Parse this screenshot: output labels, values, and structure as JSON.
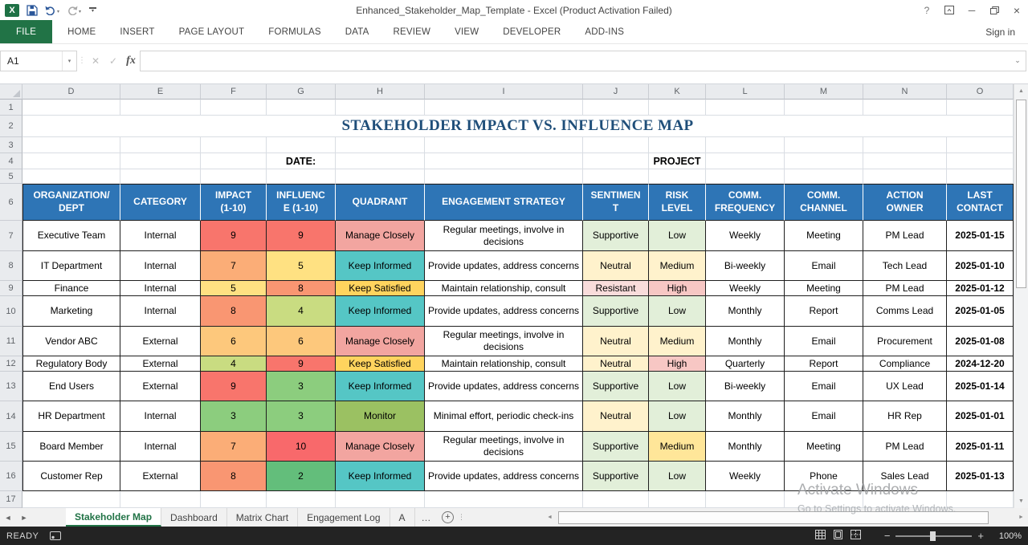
{
  "titlebar": {
    "title": "Enhanced_Stakeholder_Map_Template - Excel (Product Activation Failed)",
    "help_glyph": "?"
  },
  "ribbon": {
    "tabs": [
      "FILE",
      "HOME",
      "INSERT",
      "PAGE LAYOUT",
      "FORMULAS",
      "DATA",
      "REVIEW",
      "VIEW",
      "DEVELOPER",
      "ADD-INS"
    ],
    "sign_in": "Sign in"
  },
  "formula_bar": {
    "name_box": "A1",
    "cancel_glyph": "✕",
    "enter_glyph": "✓",
    "fx_label": "fx",
    "formula_value": ""
  },
  "grid": {
    "column_letters": [
      "D",
      "E",
      "F",
      "G",
      "H",
      "I",
      "J",
      "K",
      "L",
      "M",
      "N",
      "O"
    ],
    "row_count": 17,
    "title": "STAKEHOLDER IMPACT VS. INFLUENCE MAP",
    "date_label": "DATE:",
    "project_label": "PROJECT"
  },
  "table": {
    "headers": [
      "ORGANIZATION/\nDEPT",
      "CATEGORY",
      "IMPACT\n(1-10)",
      "INFLUENC\nE (1-10)",
      "QUADRANT",
      "ENGAGEMENT STRATEGY",
      "SENTIMEN\nT",
      "RISK\nLEVEL",
      "COMM.\nFREQUENCY",
      "COMM.\nCHANNEL",
      "ACTION\nOWNER",
      "LAST\nCONTACT"
    ],
    "rows": [
      {
        "org": "Executive Team",
        "category": "Internal",
        "impact": "9",
        "impact_color": "#F8756C",
        "influence": "9",
        "influence_color": "#F8756C",
        "quadrant": "Manage Closely",
        "quadrant_color": "#F2A5A0",
        "strategy": "Regular meetings, involve in decisions",
        "sentiment": "Supportive",
        "sentiment_color": "#E2EFD9",
        "risk": "Low",
        "risk_color": "#E2EFD9",
        "frequency": "Weekly",
        "channel": "Meeting",
        "owner": "PM Lead",
        "last_contact": "2025-01-15"
      },
      {
        "org": "IT Department",
        "category": "Internal",
        "impact": "7",
        "impact_color": "#FBAD77",
        "influence": "5",
        "influence_color": "#FFE182",
        "quadrant": "Keep Informed",
        "quadrant_color": "#55C6C5",
        "strategy": "Provide updates, address concerns",
        "sentiment": "Neutral",
        "sentiment_color": "#FFF2CC",
        "risk": "Medium",
        "risk_color": "#FFF2CC",
        "frequency": "Bi-weekly",
        "channel": "Email",
        "owner": "Tech Lead",
        "last_contact": "2025-01-10"
      },
      {
        "org": "Finance",
        "category": "Internal",
        "impact": "5",
        "impact_color": "#FFE182",
        "influence": "8",
        "influence_color": "#F99672",
        "quadrant": "Keep Satisfied",
        "quadrant_color": "#FFD45E",
        "strategy": "Maintain relationship, consult",
        "sentiment": "Resistant",
        "sentiment_color": "#F9DCDB",
        "risk": "High",
        "risk_color": "#F7C7C4",
        "frequency": "Weekly",
        "channel": "Meeting",
        "owner": "PM Lead",
        "last_contact": "2025-01-12"
      },
      {
        "org": "Marketing",
        "category": "Internal",
        "impact": "8",
        "impact_color": "#F99672",
        "influence": "4",
        "influence_color": "#C9DC81",
        "quadrant": "Keep Informed",
        "quadrant_color": "#55C6C5",
        "strategy": "Provide updates, address concerns",
        "sentiment": "Supportive",
        "sentiment_color": "#E2EFD9",
        "risk": "Low",
        "risk_color": "#E2EFD9",
        "frequency": "Monthly",
        "channel": "Report",
        "owner": "Comms Lead",
        "last_contact": "2025-01-05"
      },
      {
        "org": "Vendor ABC",
        "category": "External",
        "impact": "6",
        "impact_color": "#FDC87C",
        "influence": "6",
        "influence_color": "#FDC87C",
        "quadrant": "Manage Closely",
        "quadrant_color": "#F2A5A0",
        "strategy": "Regular meetings, involve in decisions",
        "sentiment": "Neutral",
        "sentiment_color": "#FFF2CC",
        "risk": "Medium",
        "risk_color": "#FFF2CC",
        "frequency": "Monthly",
        "channel": "Email",
        "owner": "Procurement",
        "last_contact": "2025-01-08"
      },
      {
        "org": "Regulatory Body",
        "category": "External",
        "impact": "4",
        "impact_color": "#C9DC81",
        "influence": "9",
        "influence_color": "#F8756C",
        "quadrant": "Keep Satisfied",
        "quadrant_color": "#FFD45E",
        "strategy": "Maintain relationship, consult",
        "sentiment": "Neutral",
        "sentiment_color": "#FFF2CC",
        "risk": "High",
        "risk_color": "#F7C7C4",
        "frequency": "Quarterly",
        "channel": "Report",
        "owner": "Compliance",
        "last_contact": "2024-12-20"
      },
      {
        "org": "End Users",
        "category": "External",
        "impact": "9",
        "impact_color": "#F8756C",
        "influence": "3",
        "influence_color": "#8CCD7E",
        "quadrant": "Keep Informed",
        "quadrant_color": "#55C6C5",
        "strategy": "Provide updates, address concerns",
        "sentiment": "Supportive",
        "sentiment_color": "#E2EFD9",
        "risk": "Low",
        "risk_color": "#E2EFD9",
        "frequency": "Bi-weekly",
        "channel": "Email",
        "owner": "UX Lead",
        "last_contact": "2025-01-14"
      },
      {
        "org": "HR Department",
        "category": "Internal",
        "impact": "3",
        "impact_color": "#8CCD7E",
        "influence": "3",
        "influence_color": "#8CCD7E",
        "quadrant": "Monitor",
        "quadrant_color": "#9BC162",
        "strategy": "Minimal effort, periodic check-ins",
        "sentiment": "Neutral",
        "sentiment_color": "#FFF2CC",
        "risk": "Low",
        "risk_color": "#E2EFD9",
        "frequency": "Monthly",
        "channel": "Email",
        "owner": "HR Rep",
        "last_contact": "2025-01-01"
      },
      {
        "org": "Board Member",
        "category": "Internal",
        "impact": "7",
        "impact_color": "#FBAD77",
        "influence": "10",
        "influence_color": "#F8696B",
        "quadrant": "Manage Closely",
        "quadrant_color": "#F2A5A0",
        "strategy": "Regular meetings, involve in decisions",
        "sentiment": "Supportive",
        "sentiment_color": "#E2EFD9",
        "risk": "Medium",
        "risk_color": "#FFE699",
        "frequency": "Monthly",
        "channel": "Meeting",
        "owner": "PM Lead",
        "last_contact": "2025-01-11"
      },
      {
        "org": "Customer Rep",
        "category": "External",
        "impact": "8",
        "impact_color": "#F99672",
        "influence": "2",
        "influence_color": "#63BE7B",
        "quadrant": "Keep Informed",
        "quadrant_color": "#55C6C5",
        "strategy": "Provide updates, address concerns",
        "sentiment": "Supportive",
        "sentiment_color": "#E2EFD9",
        "risk": "Low",
        "risk_color": "#E2EFD9",
        "frequency": "Weekly",
        "channel": "Phone",
        "owner": "Sales Lead",
        "last_contact": "2025-01-13"
      }
    ]
  },
  "sheet_tabs": {
    "tabs": [
      {
        "label": "Stakeholder Map",
        "active": true
      },
      {
        "label": "Dashboard",
        "active": false
      },
      {
        "label": "Matrix Chart",
        "active": false
      },
      {
        "label": "Engagement Log",
        "active": false
      },
      {
        "label": "A",
        "active": false
      }
    ],
    "overflow_glyph": "…",
    "add_label": "+"
  },
  "status_bar": {
    "mode": "READY",
    "zoom": "100%"
  },
  "watermark": {
    "line1": "Activate Windows",
    "line2": "Go to Settings to activate Windows."
  },
  "glyphs": {
    "nav_left": "◄",
    "nav_right": "►",
    "scroll_up": "▲",
    "scroll_down": "▼",
    "dropdown": "▾",
    "chevron_down": "⌄",
    "splitter": "⋮",
    "minimize": "─",
    "close": "×"
  },
  "colors": {
    "header_fill": "#2E75B6",
    "title_text": "#1F4E79",
    "file_tab_green": "#217346",
    "active_sheet_tab_green": "#217346"
  }
}
